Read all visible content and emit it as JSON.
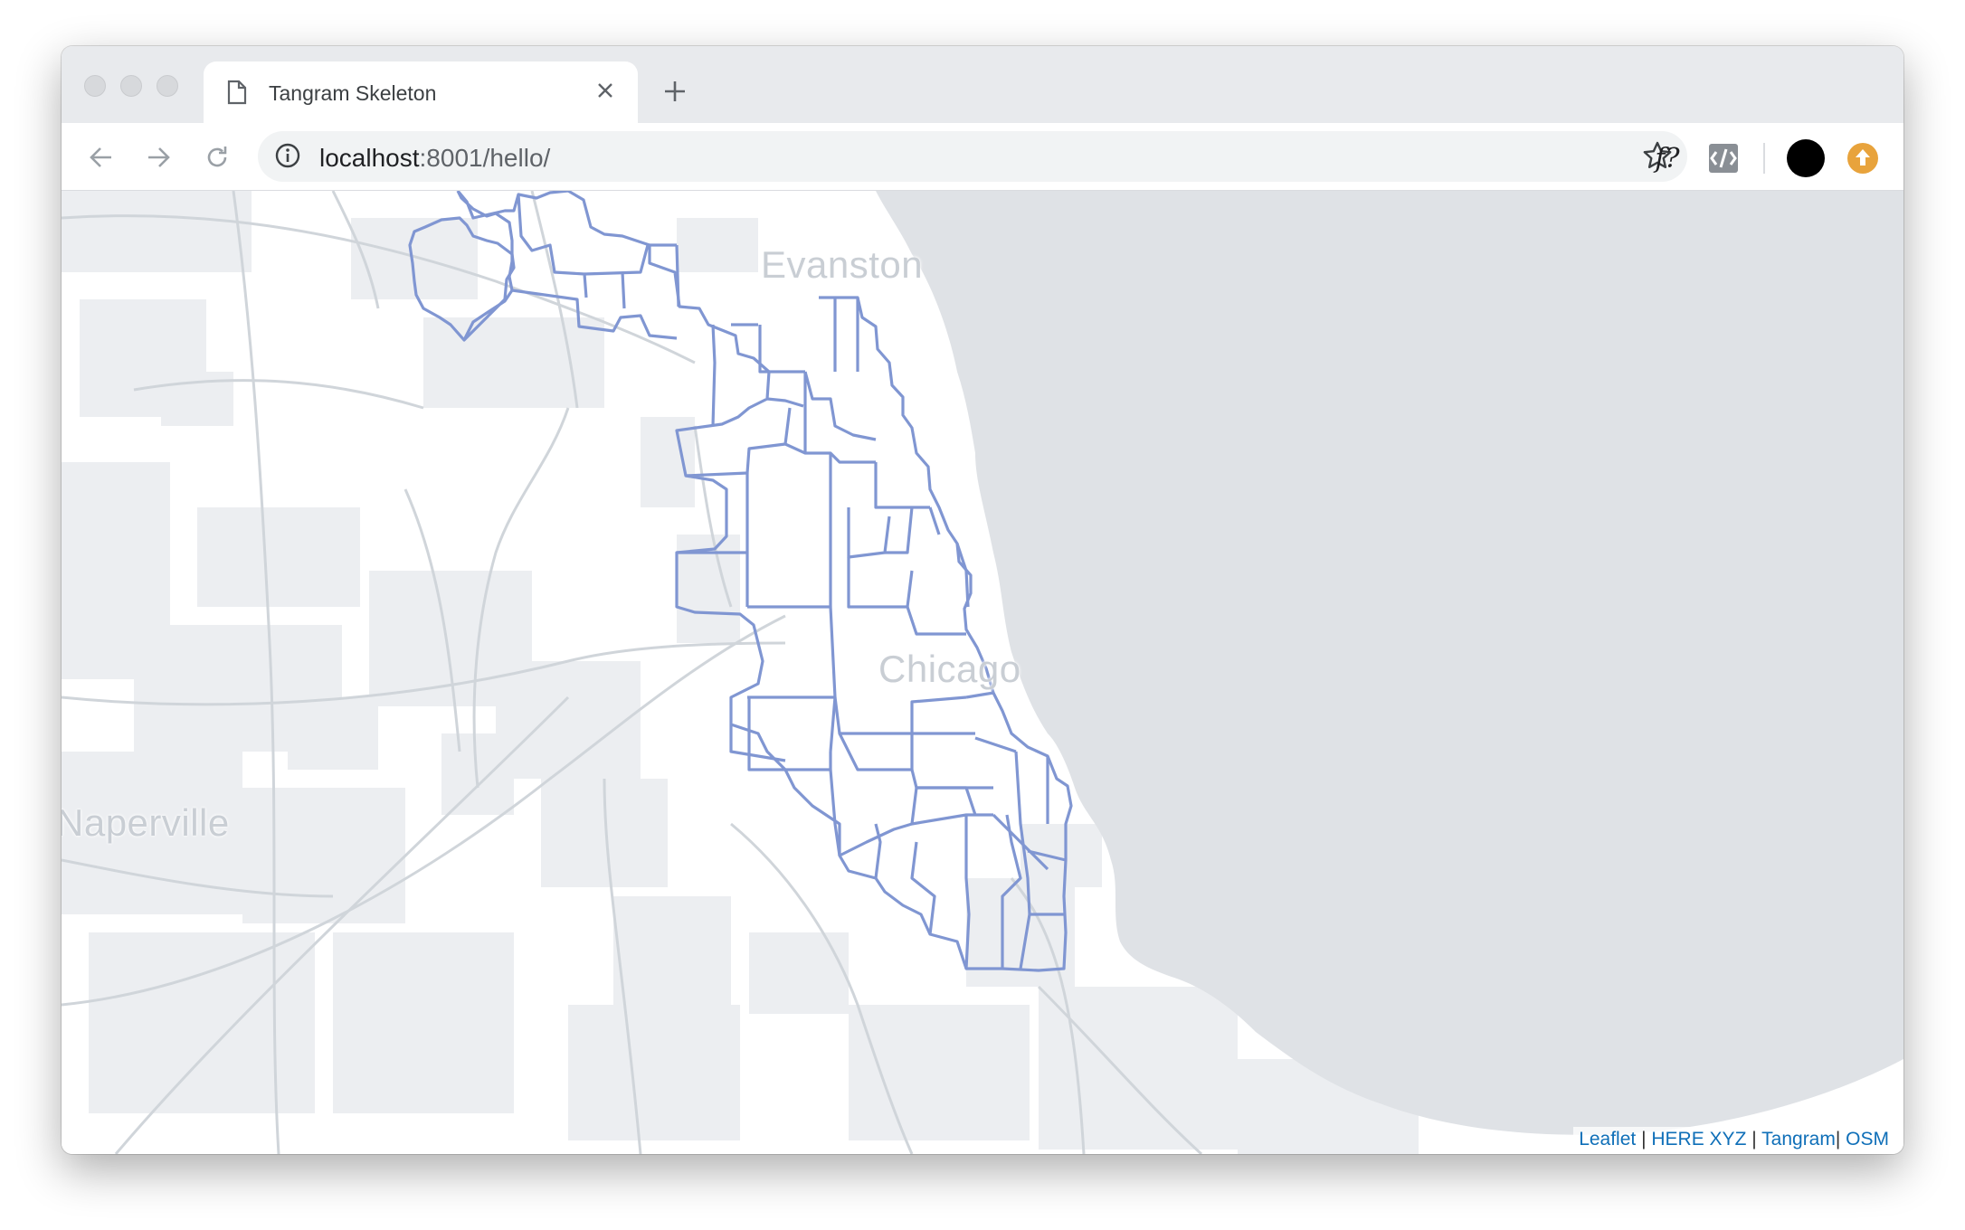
{
  "browser": {
    "tab_title": "Tangram Skeleton",
    "url_host": "localhost",
    "url_path": ":8001/hello/",
    "extension_label": "f?"
  },
  "map": {
    "labels": {
      "evanston": "Evanston",
      "chicago": "Chicago",
      "naperville": "Naperville"
    },
    "attribution": {
      "leaflet": "Leaflet",
      "here": "HERE XYZ",
      "tangram": "Tangram",
      "osm": "OSM"
    },
    "colors": {
      "land": "#ffffff",
      "water": "#dfe2e6",
      "urban": "#e9ecef",
      "roads": "#d0d5da",
      "boundaries": "#8096d2"
    }
  }
}
